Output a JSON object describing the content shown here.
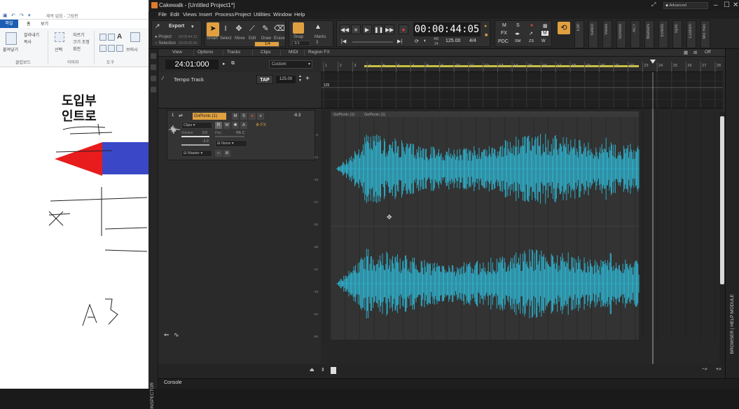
{
  "paint": {
    "title": "제목 없음 - 그림판",
    "tabs": [
      "파일",
      "홈",
      "보기"
    ],
    "clipboard": {
      "paste": "붙여넣기",
      "cut": "잘라내기",
      "copy": "복사",
      "group": "클립보드"
    },
    "image": {
      "select": "선택",
      "crop": "자르기",
      "resize": "크기 조정",
      "rotate": "회전",
      "group": "이미지"
    },
    "tools": {
      "group": "도구",
      "brush": "브러시"
    },
    "canvas_text_1": "도입부",
    "canvas_text_2": "인트로"
  },
  "cakewalk": {
    "title": "Cakewalk - [Untitled Project1*]",
    "workspace": "Advanced",
    "menus": [
      "File",
      "Edit",
      "Views",
      "Insert",
      "Process",
      "Project",
      "Utilities",
      "Window",
      "Help"
    ],
    "export": {
      "label": "Export",
      "project": "Project",
      "selection": "Selection",
      "project_time": "00:00:44:12",
      "selection_time": "00:00:00:00"
    },
    "tools": [
      "Smart",
      "Select",
      "Move",
      "Edit",
      "Draw",
      "Erase"
    ],
    "snap": {
      "label": "Snap",
      "value": "1/4",
      "value2": "1/1"
    },
    "marks_label": "Marks",
    "transport": {
      "time": "00:00:44:05",
      "tempo": "125.00",
      "meter": "4/4",
      "sig_top": "4/8",
      "sig_bottom": "24"
    },
    "mix": {
      "m": "M",
      "s": "S",
      "fx": "FX",
      "pdc": "PDC",
      "sm": "SM",
      "zs": "ZS",
      "w": "W",
      "r": "R"
    },
    "side_tabs": [
      "Edit",
      "Select",
      "Views",
      "Screens",
      "ACT",
      "Markers",
      "Events",
      "Sync",
      "Custom",
      "Mix Rec"
    ],
    "view_menu": [
      "View",
      "Options",
      "Tracks",
      "Clips",
      "MIDI",
      "Region FX"
    ],
    "now_time": "24:01:000",
    "custom_select": "Custom",
    "tempo_track": {
      "label": "Tempo Track",
      "tap": "TAP",
      "value": "125.00",
      "lane_value": "125"
    },
    "track": {
      "number": "1",
      "name": "GoPicnic (1)",
      "m": "M",
      "s": "S",
      "r": "R",
      "w": "W",
      "a": "A",
      "volume": "-6.3",
      "clips": "Clips",
      "fx_label": "FX",
      "volume_label": "Volume",
      "volume_val": "0.0",
      "pan_label": "Pan",
      "pan_val": "0% C",
      "gain_val": "-3.0",
      "input": "None",
      "output": "Master"
    },
    "clip_labels": [
      "GoPicnic (1)",
      "GoPicnic (1)"
    ],
    "ruler": [
      "1",
      "2",
      "3",
      "4",
      "5",
      "6",
      "7",
      "8",
      "9",
      "10",
      "11",
      "12",
      "13",
      "14",
      "15",
      "16",
      "17",
      "18",
      "19",
      "20",
      "21",
      "22",
      "23",
      "24",
      "25",
      "26",
      "27",
      "28"
    ],
    "db_scale": [
      "-6",
      "-12",
      "-18",
      "-24",
      "-30",
      "-36",
      "-42",
      "-48",
      "-54",
      "-60"
    ],
    "console": "Console",
    "inspector": "INSPECTOR",
    "browser": "BROWSER | HELP MODULE",
    "off": "Off",
    "colors": {
      "wave": "#2fb9d6",
      "accent": "#e0a040",
      "bg": "#2b2b2b"
    }
  }
}
